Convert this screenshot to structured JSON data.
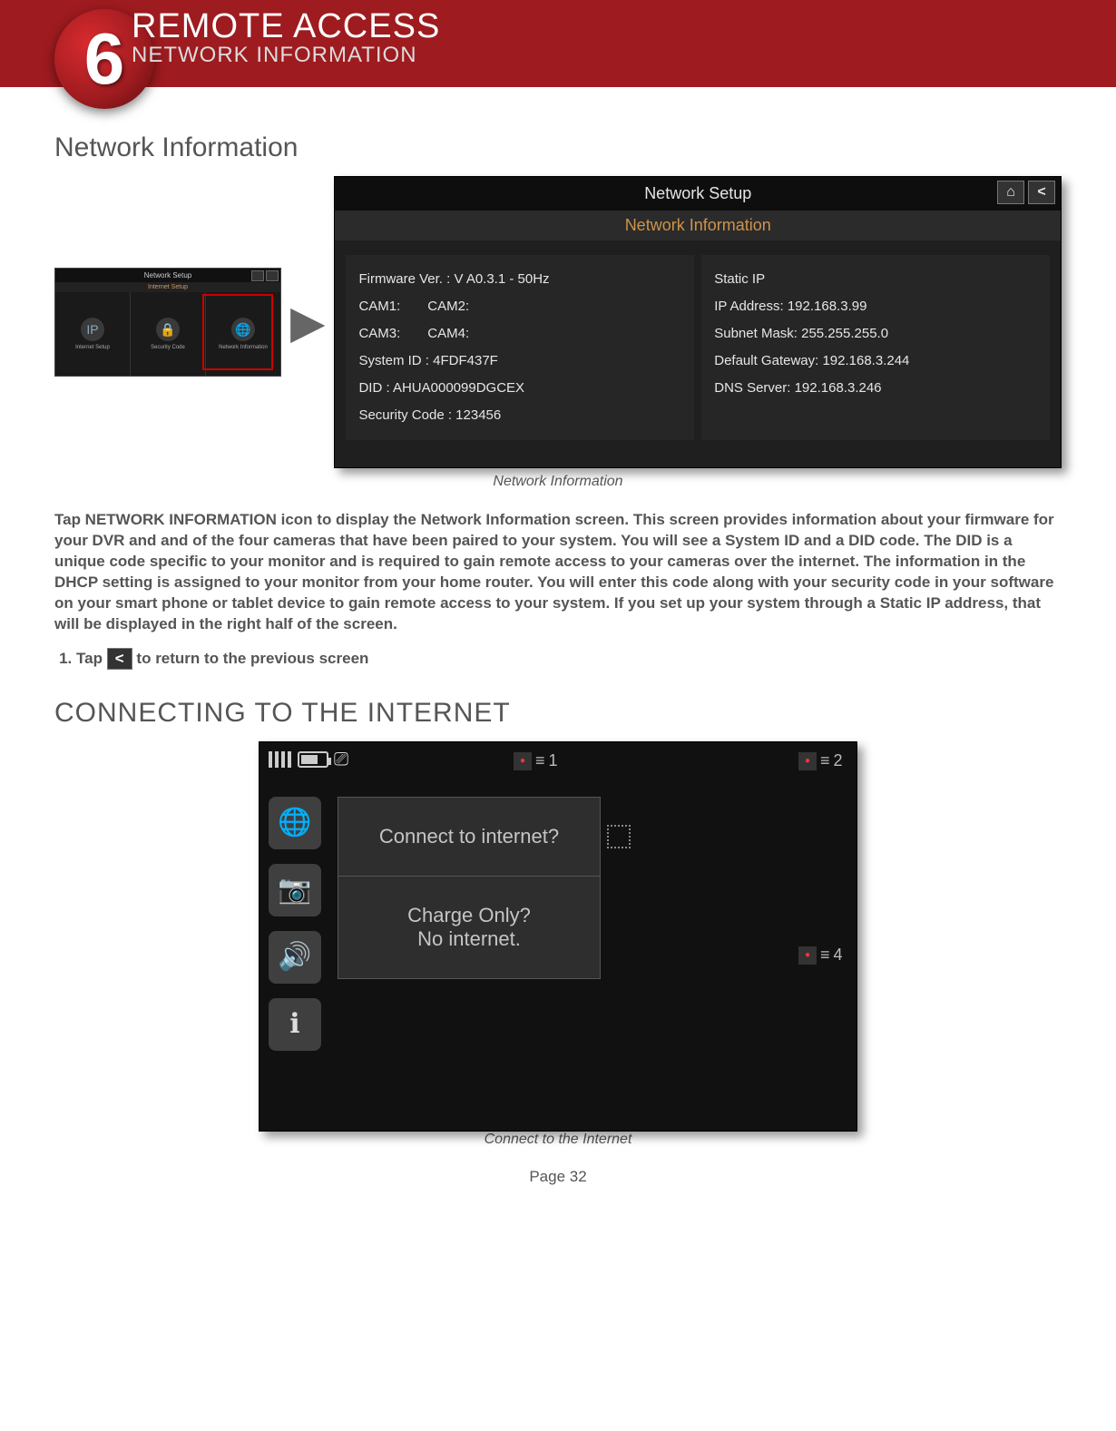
{
  "header": {
    "chapter_number": "6",
    "title": "REMOTE ACCESS",
    "subtitle": "NETWORK INFORMATION"
  },
  "section1_title": "Network Information",
  "thumb": {
    "top": "Network Setup",
    "sub": "Internet Setup",
    "cells": [
      "Internet Setup",
      "Security Code",
      "Network Information"
    ]
  },
  "main_screen": {
    "title": "Network Setup",
    "subtitle": "Network Information",
    "left": {
      "firmware": "Firmware Ver. : V A0.3.1 - 50Hz",
      "cam1": "CAM1:",
      "cam2": "CAM2:",
      "cam3": "CAM3:",
      "cam4": "CAM4:",
      "system_id": "System ID : 4FDF437F",
      "did": "DID : AHUA000099DGCEX",
      "security_code": "Security Code : 123456"
    },
    "right": {
      "mode": "Static IP",
      "ip": "IP Address: 192.168.3.99",
      "mask": "Subnet Mask: 255.255.255.0",
      "gateway": "Default Gateway: 192.168.3.244",
      "dns": "DNS Server: 192.168.3.246"
    }
  },
  "figcap1": "Network Information",
  "body_p1": "Tap NETWORK INFORMATION icon to display the Network Information screen. This screen provides information about your firmware for your DVR and and of the four cameras that have been paired to your system. You will see a System ID and a DID code. The DID is a unique code specific to your monitor and is required to gain remote access to your cameras over the internet. The information in the DHCP setting is assigned to your monitor from your home router. You will enter this code along with your security code in your software on your smart phone or tablet device to gain remote access to your system. If you set up your system through a Static IP address, that will be displayed in the right half of the screen.",
  "step1_pre": "Tap ",
  "step1_post": " to return to the previous screen",
  "section2_title": "CONNECTING TO THE INTERNET",
  "connect": {
    "opt1": "Connect to internet?",
    "opt2a": "Charge Only?",
    "opt2b": "No internet.",
    "cam1": "1",
    "cam2": "2",
    "cam4": "4"
  },
  "figcap2": "Connect to the Internet",
  "page_label": "Page 32"
}
